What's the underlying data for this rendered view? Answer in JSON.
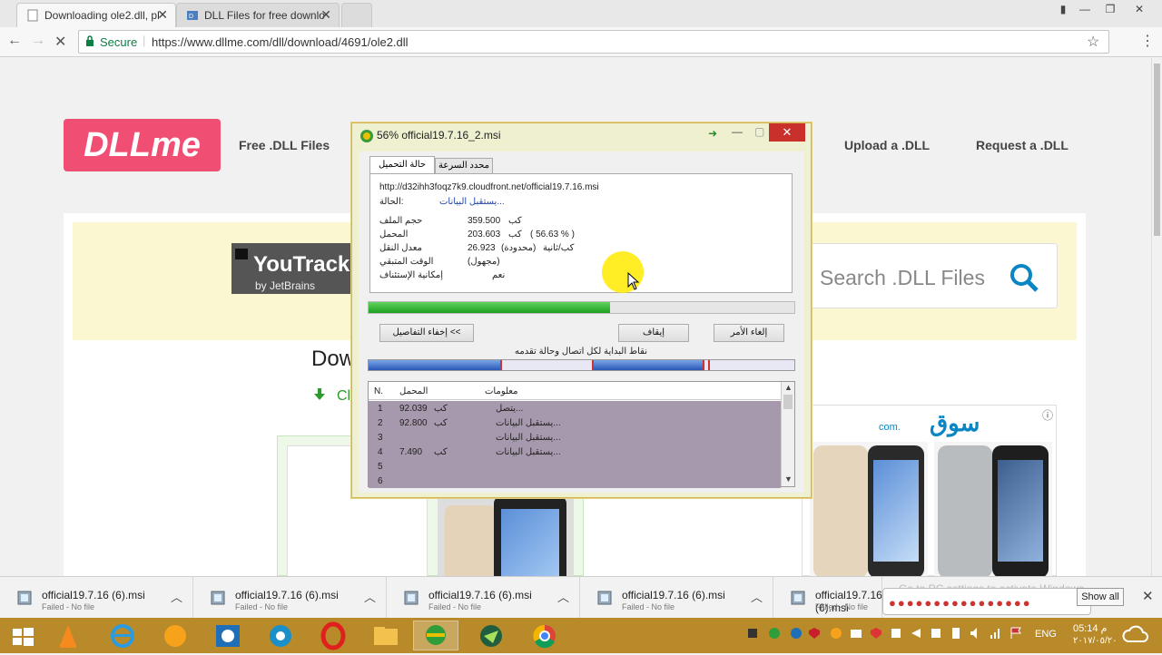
{
  "browser": {
    "tabs": [
      {
        "label": "Downloading ole2.dll, pl"
      },
      {
        "label": "DLL Files for free downlo"
      }
    ],
    "secure_label": "Secure",
    "url": "https://www.dllme.com/dll/download/4691/ole2.dll"
  },
  "site": {
    "logo": "DLLme",
    "nav": [
      "Free .DLL Files",
      "Upload a .DLL",
      "Request a .DLL"
    ],
    "ad_brand": "YouTrack",
    "ad_sub": "by JetBrains",
    "search_placeholder": "Search .DLL Files",
    "heading_partial": "Dow",
    "link_partial": "Cli",
    "souq_logo": "سوق",
    "souq_sub": "com."
  },
  "dialog": {
    "title": "56% official19.7.16_2.msi",
    "tabs": [
      "حالة التحميل",
      "محدد السرعة"
    ],
    "url": "http://d32ihh3foqz7k9.cloudfront.net/official19.7.16.msi",
    "status_label": "الحالة:",
    "status_value": "يستقبل البيانات...",
    "rows": [
      {
        "label": "حجم الملف",
        "value": "359.500",
        "unit": "كب"
      },
      {
        "label": "المحمل",
        "value": "203.603",
        "unit": "كب",
        "extra": "( 56.63 % )"
      },
      {
        "label": "معدل النقل",
        "value": "26.923",
        "unit": "(محدودة)",
        "extra": "كب/ثانية"
      },
      {
        "label": "الوقت المتبقي",
        "value": "(مجهول)"
      },
      {
        "label": "إمكانية الإستئناف",
        "value": "نعم"
      }
    ],
    "progress": 0.5663,
    "buttons": {
      "details": "إخفاء التفاصيل <<",
      "pause": "إيقاف",
      "cancel": "إلغاء الأمر"
    },
    "segments_label": "نقاط البداية لكل اتصال وحالة تقدمه",
    "table_headers": [
      "N.",
      "المحمل",
      "معلومات"
    ],
    "table_rows": [
      {
        "n": "1",
        "amount": "92.039",
        "unit": "كب",
        "info": "يتصل..."
      },
      {
        "n": "2",
        "amount": "92.800",
        "unit": "كب",
        "info": "يستقبل البيانات..."
      },
      {
        "n": "3",
        "amount": "",
        "unit": "",
        "info": "يستقبل البيانات..."
      },
      {
        "n": "4",
        "amount": "7.490",
        "unit": "كب",
        "info": "يستقبل البيانات..."
      },
      {
        "n": "5",
        "amount": "",
        "unit": "",
        "info": ""
      },
      {
        "n": "6",
        "amount": "",
        "unit": "",
        "info": ""
      }
    ]
  },
  "shelf": {
    "items": [
      {
        "name": "official19.7.16 (6).msi",
        "status": "Failed - No file"
      },
      {
        "name": "official19.7.16 (6).msi",
        "status": "Failed - No file"
      },
      {
        "name": "official19.7.16 (6).msi",
        "status": "Failed - No file"
      },
      {
        "name": "official19.7.16 (6).msi",
        "status": "Failed - No file"
      },
      {
        "name": "official19.7.16 (6).msi",
        "status": "Failed - No file"
      }
    ],
    "show_all": "Show all",
    "watermark": "Go to PC settings to activate Windows."
  },
  "taskbar": {
    "lang": "ENG",
    "time": "05:14 م",
    "date": "٢٠١٧/٠٥/٢٠"
  },
  "colors": {
    "accent_pink": "#f04e73",
    "progress_green": "#2fb52f",
    "taskbar": "#b98a2a",
    "search_blue": "#0a86c4"
  }
}
